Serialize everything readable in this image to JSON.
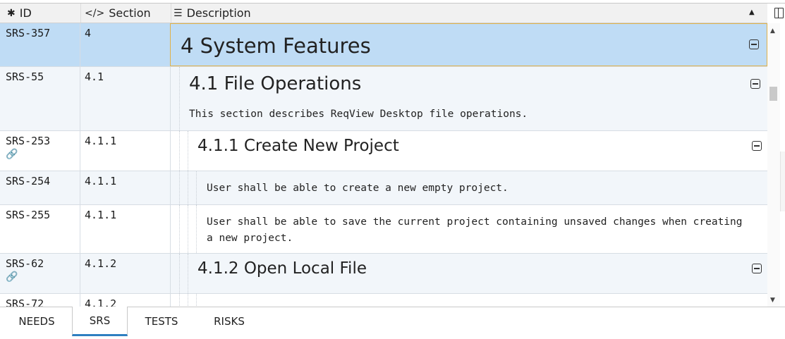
{
  "header": {
    "id_label": "ID",
    "section_label": "Section",
    "description_label": "Description"
  },
  "rows": [
    {
      "id": "SRS-357",
      "section": "4",
      "kind": "heading",
      "text": "4 System Features",
      "selected": true
    },
    {
      "id": "SRS-55",
      "section": "4.1",
      "kind": "heading",
      "text": "4.1 File Operations",
      "body": "This section describes ReqView Desktop file operations."
    },
    {
      "id": "SRS-253",
      "section": "4.1.1",
      "kind": "heading",
      "text": "4.1.1 Create New Project",
      "linked": true
    },
    {
      "id": "SRS-254",
      "section": "4.1.1",
      "kind": "text",
      "text": "User shall be able to create a new empty project."
    },
    {
      "id": "SRS-255",
      "section": "4.1.1",
      "kind": "text",
      "text": "User shall be able to save the current project containing unsaved changes when creating",
      "text2": "a new project."
    },
    {
      "id": "SRS-62",
      "section": "4.1.2",
      "kind": "heading",
      "text": "4.1.2 Open Local File",
      "linked": true
    },
    {
      "id": "SRS-72",
      "section": "4.1.2",
      "kind": "text",
      "text": ""
    }
  ],
  "tabs": [
    {
      "label": "NEEDS",
      "active": false
    },
    {
      "label": "SRS",
      "active": true
    },
    {
      "label": "TESTS",
      "active": false
    },
    {
      "label": "RISKS",
      "active": false
    }
  ],
  "icons": {
    "id_column": "asterisk-icon",
    "section_column": "code-icon",
    "description_column": "align-left-icon",
    "link": "link-icon",
    "collapse": "collapse-icon"
  },
  "colors": {
    "selected_row": "#bfdcf5",
    "selected_border": "#e0b24a",
    "alt_row": "#f2f6fa",
    "active_tab_underline": "#2e7fc1"
  }
}
